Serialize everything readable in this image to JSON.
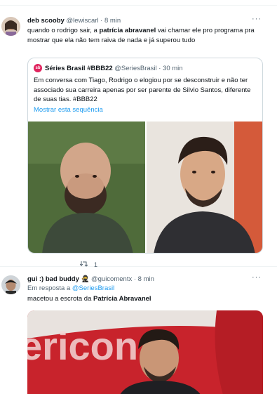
{
  "tweets": [
    {
      "name": "deb scooby",
      "handle": "@lewiscarl",
      "separator": "·",
      "time": "8 min",
      "more": "···",
      "text_parts": [
        "quando o rodrigo sair, a ",
        "patrícia abravanel",
        " vai chamar ele pro programa pra mostrar que ela não tem raiva de nada e já superou tudo"
      ],
      "quote": {
        "avatar_text": "sb",
        "name": "Séries Brasil #BBB22",
        "handle": "@SeriesBrasil",
        "separator": "·",
        "time": "30 min",
        "text": "Em conversa com Tiago, Rodrigo o elogiou por se desconstruir e não ter associado sua carreira apenas por ser parente de Silvio Santos, diferente de suas tias. #BBB22",
        "show_thread": "Mostrar esta sequência"
      },
      "actions": {
        "reply_count": "1"
      }
    },
    {
      "name": "gui :) bad buddy 🥷",
      "handle": "@guicomentx",
      "separator": "·",
      "time": "8 min",
      "more": "···",
      "reply_prefix": "Em resposta a ",
      "reply_to": "@SeriesBrasil",
      "text_parts": [
        "macetou a escrota da ",
        "Patrícia Abravanel"
      ]
    }
  ],
  "colors": {
    "accent": "#1d9bf0",
    "secondary_text": "#536471",
    "border": "#cfd9de"
  }
}
